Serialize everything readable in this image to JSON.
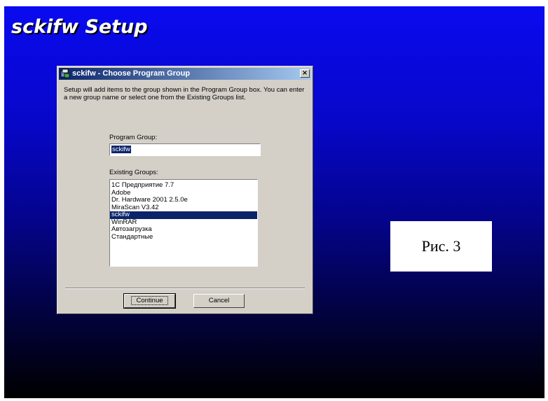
{
  "setup": {
    "title": "sckifw Setup"
  },
  "dialog": {
    "title": "sckifw - Choose Program Group",
    "close_label": "×",
    "description": "Setup will add items to the group shown in the Program Group box. You can enter a new group name or select one from the Existing Groups list.",
    "program_group_label": "Program Group:",
    "program_group_value": "sckifw",
    "existing_groups_label": "Existing Groups:",
    "existing_groups": [
      "1С Предприятие 7.7",
      "Adobe",
      "Dr. Hardware 2001 2.5.0e",
      "MiraScan V3.42",
      "sckifw",
      "WinRAR",
      "Автозагрузка",
      "Стандартные"
    ],
    "selected_group": "sckifw",
    "continue_label": "Continue",
    "cancel_label": "Cancel"
  },
  "caption": {
    "text": "Рис. 3"
  },
  "colors": {
    "desktop_top": "#0a0af0",
    "desktop_bottom": "#000000",
    "titlebar": "#0a246a",
    "selection": "#0a246a",
    "dialog_face": "#d4d0c8"
  },
  "icons": {
    "app": "installer-icon",
    "close": "close-icon"
  }
}
